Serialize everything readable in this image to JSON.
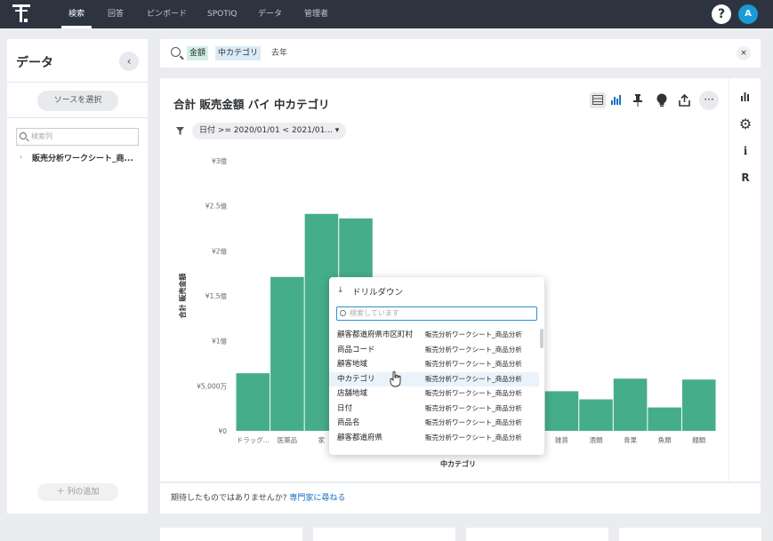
{
  "nav": {
    "tabs": [
      "検索",
      "回答",
      "ピンボード",
      "SPOTIQ",
      "データ",
      "管理者"
    ],
    "active_tab": "検索",
    "help_label": "?",
    "avatar_label": "A"
  },
  "left_panel": {
    "title": "データ",
    "collapse_icon": "chevron-left-icon",
    "source_button": "ソースを選択",
    "column_search_placeholder": "検索列",
    "tree_item": "販売分析ワークシート_商...",
    "add_column": "＋ 列の追加"
  },
  "search": {
    "tokens": [
      "金額",
      "中カテゴリ",
      "去年"
    ],
    "clear_label": "×"
  },
  "answer": {
    "title": "合計 販売金額 バイ 中カテゴリ",
    "filter_chip": "日付 >= 2020/01/01 < 2021/01... ▾",
    "toolbar_icons": [
      "table-icon",
      "bar-chart-icon",
      "pin-icon",
      "lightbulb-icon",
      "share-icon",
      "more-icon"
    ],
    "more_label": "···"
  },
  "right_rail": {
    "icons": [
      "chart-settings-icon",
      "gear-icon",
      "info-icon",
      "r-icon"
    ],
    "info_label": "i",
    "r_label": "R"
  },
  "feedback": {
    "text": "期待したものではありませんか?",
    "link": "専門家に尋ねる"
  },
  "drill_popup": {
    "title": "ドリルダウン",
    "search_placeholder": "検索しています",
    "items": [
      {
        "name": "顧客都道府県市区町村",
        "source": "販売分析ワークシート_商品分析"
      },
      {
        "name": "商品コード",
        "source": "販売分析ワークシート_商品分析"
      },
      {
        "name": "顧客地域",
        "source": "販売分析ワークシート_商品分析"
      },
      {
        "name": "中カテゴリ",
        "source": "販売分析ワークシート_商品分析"
      },
      {
        "name": "店舗地域",
        "source": "販売分析ワークシート_商品分析"
      },
      {
        "name": "日付",
        "source": "販売分析ワークシート_商品分析"
      },
      {
        "name": "商品名",
        "source": "販売分析ワークシート_商品分析"
      },
      {
        "name": "顧客都道府県",
        "source": "販売分析ワークシート_商品分析"
      }
    ],
    "highlighted_index": 3
  },
  "chart_data": {
    "type": "bar",
    "title": "",
    "xlabel": "中カテゴリ",
    "ylabel": "合計 販売金額",
    "ylim": [
      0,
      300000000
    ],
    "y_ticks": [
      0,
      50000000,
      100000000,
      150000000,
      200000000,
      250000000,
      300000000
    ],
    "y_tick_labels": [
      "¥0",
      "¥5,000万",
      "¥1億",
      "¥1.5億",
      "¥2億",
      "¥2.5億",
      "¥3億"
    ],
    "categories": [
      "ドラッグ...",
      "医薬品",
      "家",
      "",
      "",
      "",
      "",
      "",
      "",
      "雑貨",
      "酒類",
      "青果",
      "魚類",
      "麺類"
    ],
    "visible_x_labels": [
      "ドラッグ...",
      "医薬品",
      "家",
      "雑貨",
      "酒類",
      "青果",
      "魚類",
      "麺類"
    ],
    "values": [
      64000000,
      171000000,
      241000000,
      236000000,
      null,
      null,
      null,
      null,
      null,
      44000000,
      35000000,
      58000000,
      26000000,
      57000000
    ],
    "bar_color": "#46ad8a",
    "grid": false,
    "legend": "none"
  },
  "colors": {
    "nav_bg": "#2d3440",
    "accent": "#46ad8a",
    "link": "#1b72c4"
  }
}
